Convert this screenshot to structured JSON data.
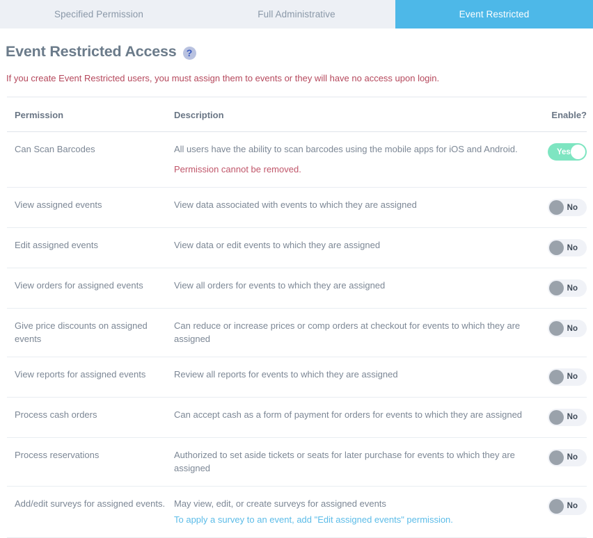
{
  "tabs": [
    {
      "label": "Specified Permission",
      "active": false
    },
    {
      "label": "Full Administrative",
      "active": false
    },
    {
      "label": "Event Restricted",
      "active": true
    }
  ],
  "page": {
    "title": "Event Restricted Access",
    "help_icon": "question-mark-icon",
    "help_glyph": "?",
    "warning": "If you create Event Restricted users, you must assign them to events or they will have no access upon login."
  },
  "table": {
    "headers": {
      "permission": "Permission",
      "description": "Description",
      "enable": "Enable?"
    },
    "rows": [
      {
        "permission": "Can Scan Barcodes",
        "description": "All users have the ability to scan barcodes using the mobile apps for iOS and Android.",
        "sub_red": "Permission cannot be removed.",
        "sub_link": "",
        "toggle": "Yes",
        "toggle_state": "on"
      },
      {
        "permission": "View assigned events",
        "description": "View data associated with events to which they are assigned",
        "sub_red": "",
        "sub_link": "",
        "toggle": "No",
        "toggle_state": "off"
      },
      {
        "permission": "Edit assigned events",
        "description": "View data or edit events to which they are assigned",
        "sub_red": "",
        "sub_link": "",
        "toggle": "No",
        "toggle_state": "off"
      },
      {
        "permission": "View orders for assigned events",
        "description": "View all orders for events to which they are assigned",
        "sub_red": "",
        "sub_link": "",
        "toggle": "No",
        "toggle_state": "off"
      },
      {
        "permission": "Give price discounts on assigned events",
        "description": "Can reduce or increase prices or comp orders at checkout for events to which they are assigned",
        "sub_red": "",
        "sub_link": "",
        "toggle": "No",
        "toggle_state": "off"
      },
      {
        "permission": "View reports for assigned events",
        "description": "Review all reports for events to which they are assigned",
        "sub_red": "",
        "sub_link": "",
        "toggle": "No",
        "toggle_state": "off"
      },
      {
        "permission": "Process cash orders",
        "description": "Can accept cash as a form of payment for orders for events to which they are assigned",
        "sub_red": "",
        "sub_link": "",
        "toggle": "No",
        "toggle_state": "off"
      },
      {
        "permission": "Process reservations",
        "description": "Authorized to set aside tickets or seats for later purchase for events to which they are assigned",
        "sub_red": "",
        "sub_link": "",
        "toggle": "No",
        "toggle_state": "off"
      },
      {
        "permission": "Add/edit surveys for assigned events.",
        "description": "May view, edit, or create surveys for assigned events",
        "sub_red": "",
        "sub_link": "To apply a survey to an event, add \"Edit assigned events\" permission.",
        "toggle": "No",
        "toggle_state": "off"
      }
    ]
  },
  "colors": {
    "active_tab": "#4db8e8",
    "inactive_tab_bg": "#edf0f5",
    "toggle_on": "#7ee5c1",
    "toggle_off": "#f0f2f7",
    "warning_red": "#b5485c",
    "link_blue": "#5cbce8"
  }
}
